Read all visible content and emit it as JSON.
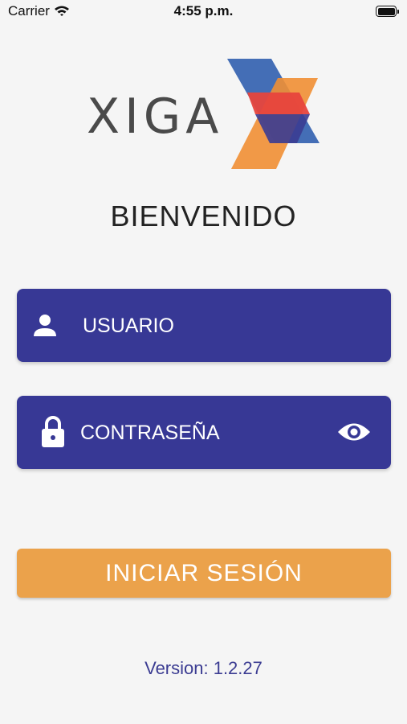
{
  "status_bar": {
    "carrier": "Carrier",
    "time": "4:55 p.m.",
    "icons": [
      "wifi-icon",
      "battery-icon"
    ]
  },
  "logo": {
    "text": "XIGA",
    "colors": {
      "blue": "#3a66b2",
      "red": "#e7453d",
      "orange": "#f18f34",
      "indigo": "#3b3c92"
    }
  },
  "welcome": "BIENVENIDO",
  "form": {
    "username": {
      "placeholder": "USUARIO",
      "icon": "user-icon"
    },
    "password": {
      "placeholder": "CONTRASEÑA",
      "icon": "lock-icon",
      "toggle_icon": "eye-icon"
    },
    "field_color": "#373895"
  },
  "login_button": {
    "label": "INICIAR SESIÓN",
    "color": "#eba24b"
  },
  "version": "Version: 1.2.27"
}
